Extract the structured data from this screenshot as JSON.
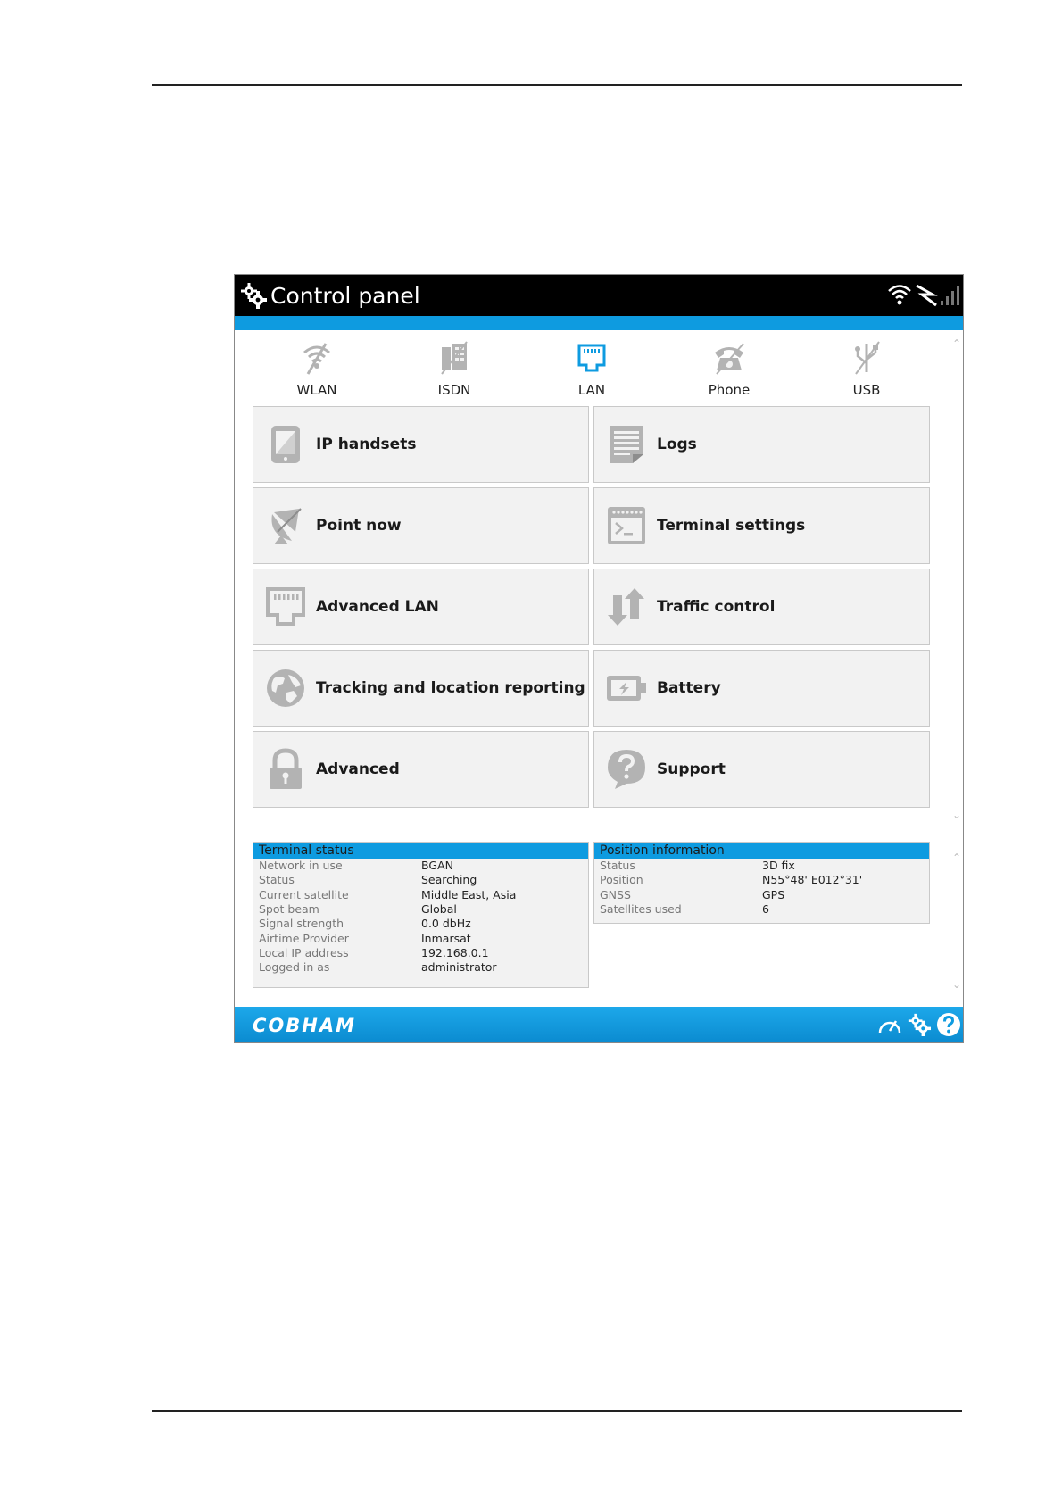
{
  "window": {
    "title": "Control panel"
  },
  "nav": [
    {
      "label": "WLAN",
      "icon": "wlan-off-icon"
    },
    {
      "label": "ISDN",
      "icon": "isdn-off-icon"
    },
    {
      "label": "LAN",
      "icon": "lan-active-icon"
    },
    {
      "label": "Phone",
      "icon": "phone-off-icon"
    },
    {
      "label": "USB",
      "icon": "usb-off-icon"
    }
  ],
  "tiles": [
    {
      "label": "IP handsets",
      "icon": "handset-icon"
    },
    {
      "label": "Logs",
      "icon": "logs-icon"
    },
    {
      "label": "Point now",
      "icon": "satellite-dish-icon"
    },
    {
      "label": "Terminal settings",
      "icon": "terminal-icon"
    },
    {
      "label": "Advanced LAN",
      "icon": "lan-port-icon"
    },
    {
      "label": "Traffic control",
      "icon": "traffic-arrows-icon"
    },
    {
      "label": "Tracking and location reporting",
      "icon": "globe-icon"
    },
    {
      "label": "Battery",
      "icon": "battery-icon"
    },
    {
      "label": "Advanced",
      "icon": "lock-icon"
    },
    {
      "label": "Support",
      "icon": "question-icon"
    }
  ],
  "terminal_status": {
    "title": "Terminal status",
    "rows": [
      {
        "key": "Network in use",
        "value": "BGAN"
      },
      {
        "key": "Status",
        "value": "Searching"
      },
      {
        "key": "Current satellite",
        "value": "Middle East, Asia"
      },
      {
        "key": "Spot beam",
        "value": "Global"
      },
      {
        "key": "Signal strength",
        "value": "0.0 dbHz"
      },
      {
        "key": "Airtime Provider",
        "value": "Inmarsat"
      },
      {
        "key": "Local IP address",
        "value": "192.168.0.1"
      },
      {
        "key": "Logged in as",
        "value": "administrator"
      }
    ]
  },
  "position_information": {
    "title": "Position information",
    "rows": [
      {
        "key": "Status",
        "value": "3D fix"
      },
      {
        "key": "Position",
        "value": "N55°48' E012°31'"
      },
      {
        "key": "GNSS",
        "value": "GPS"
      },
      {
        "key": "Satellites used",
        "value": "6"
      }
    ]
  },
  "footer": {
    "brand": "COBHAM"
  },
  "colors": {
    "accent": "#0e9be0",
    "titlebar": "#000000",
    "tile_bg": "#f2f2f2",
    "icon_grey": "#b3b3b3"
  }
}
